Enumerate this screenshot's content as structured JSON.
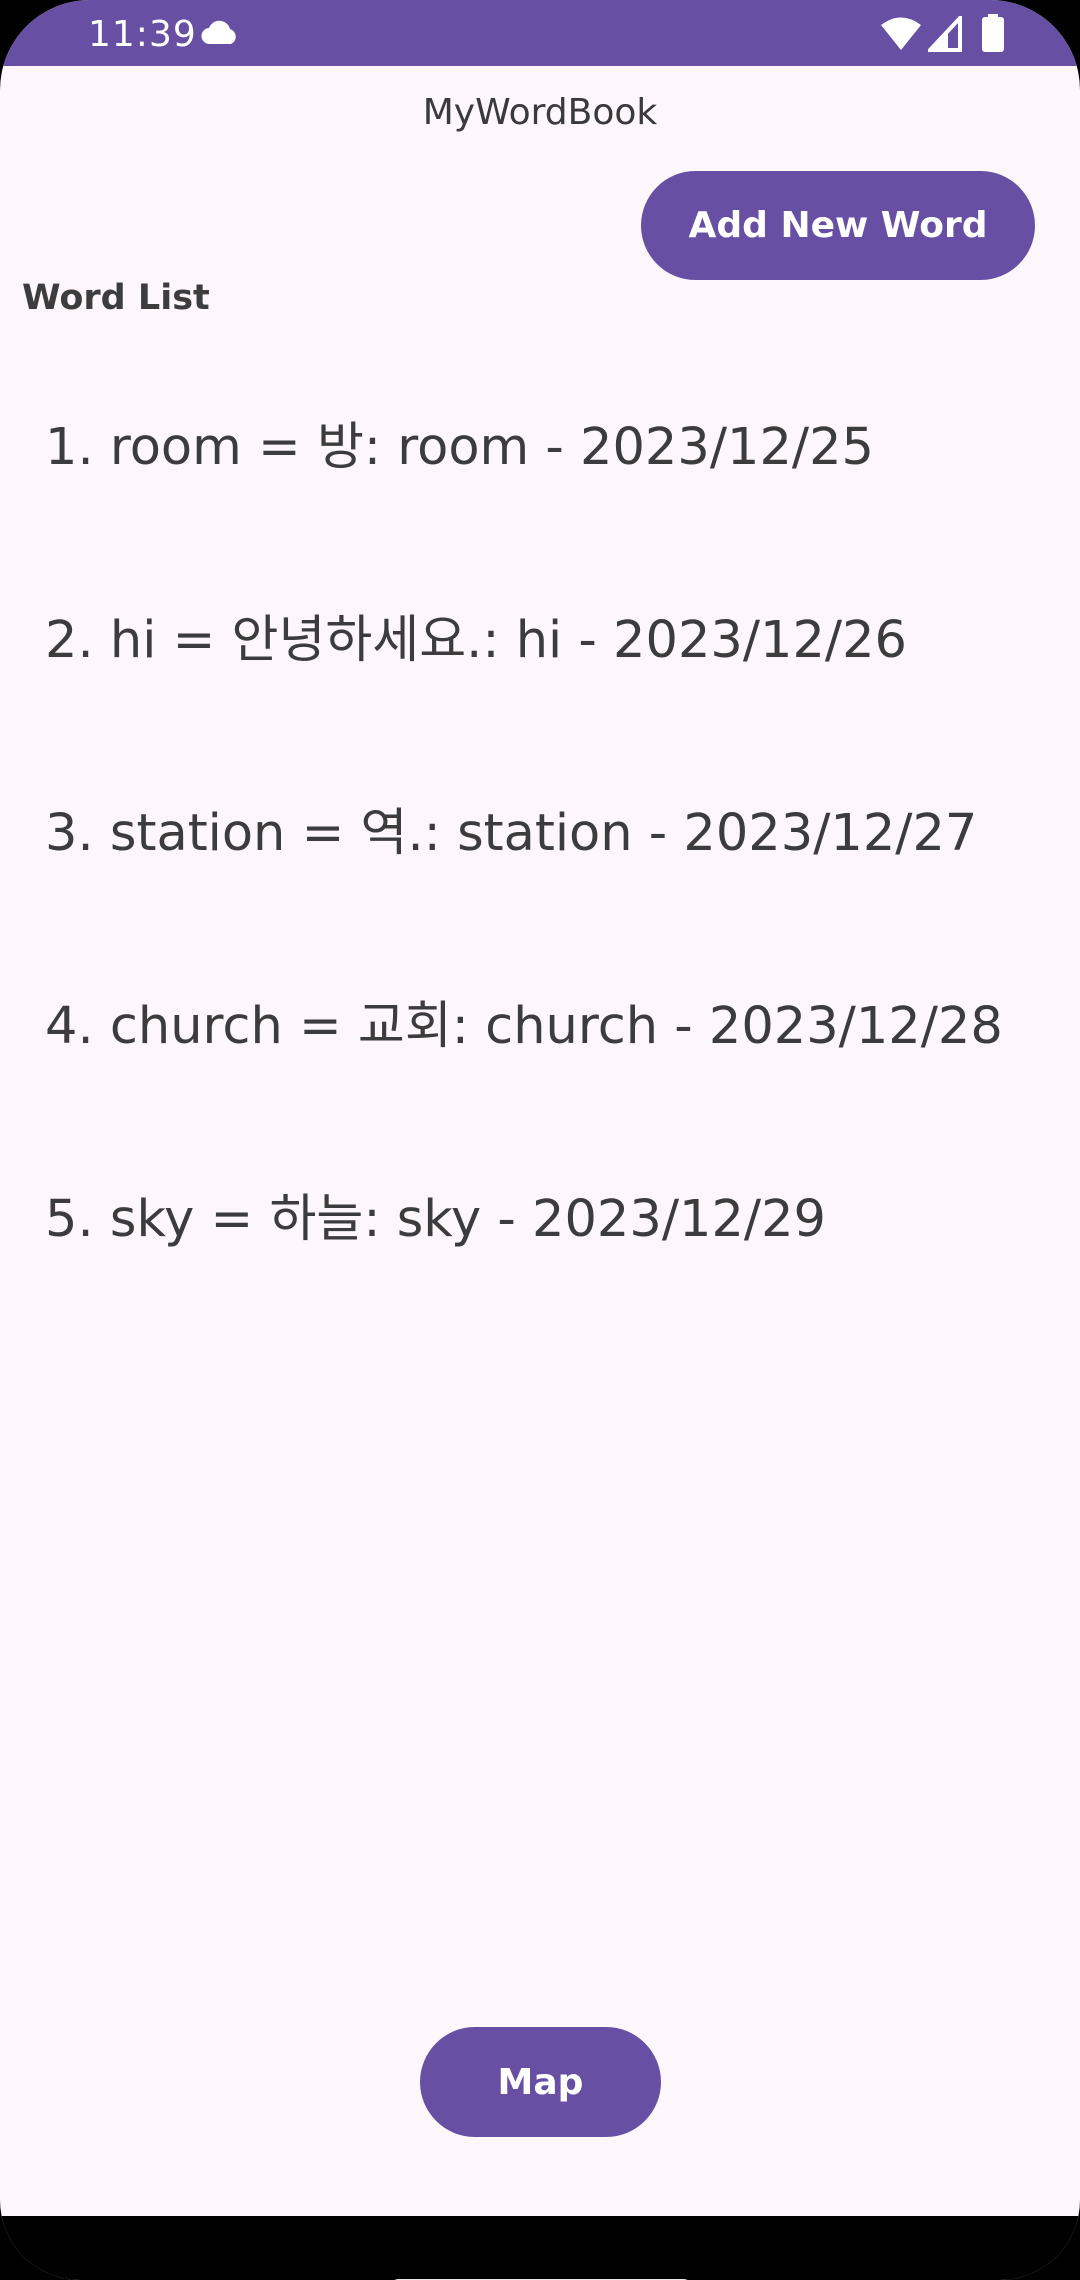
{
  "status_bar": {
    "time": "11:39",
    "icons": [
      "cloud-icon",
      "wifi-icon",
      "signal-icon",
      "battery-icon"
    ],
    "background": "#6750a4"
  },
  "app": {
    "title": "MyWordBook",
    "add_button_label": "Add New Word",
    "list_heading": "Word List",
    "words": [
      "1. room = 방: room - 2023/12/25",
      "2. hi = 안녕하세요.: hi - 2023/12/26",
      "3. station = 역.: station - 2023/12/27",
      "4. church = 교회: church - 2023/12/28",
      "5. sky = 하늘: sky - 2023/12/29"
    ],
    "map_button_label": "Map"
  },
  "colors": {
    "accent": "#6750a4",
    "background": "#fdf6fb",
    "text": "#3c3c3c"
  }
}
